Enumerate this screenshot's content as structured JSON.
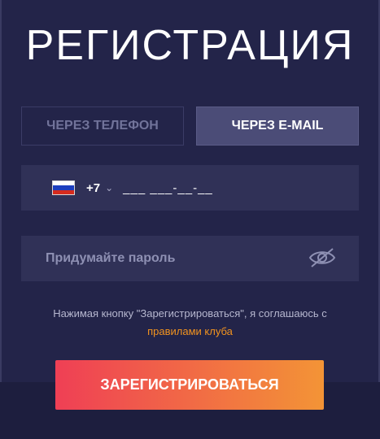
{
  "title": "РЕГИСТРАЦИЯ",
  "tabs": [
    {
      "label": "ЧЕРЕЗ ТЕЛЕФОН",
      "active": false
    },
    {
      "label": "ЧЕРЕЗ E-MAIL",
      "active": true
    }
  ],
  "phone": {
    "country_code": "+7",
    "mask": "___ ___-__-__",
    "flag_icon": "russia-flag-icon"
  },
  "password": {
    "placeholder": "Придумайте пароль",
    "toggle_icon": "eye-off-icon"
  },
  "agreement": {
    "text": "Нажимая кнопку \"Зарегистрироваться\", я соглашаюсь с",
    "link_text": "правилами клуба"
  },
  "register_button": {
    "label": "ЗАРЕГИСТРИРОВАТЬСЯ"
  },
  "colors": {
    "background": "#232449",
    "field": "#303157",
    "active_tab": "#4b4c77",
    "link": "#f2931f",
    "button_start": "#ef3f55",
    "button_end": "#f39436"
  }
}
